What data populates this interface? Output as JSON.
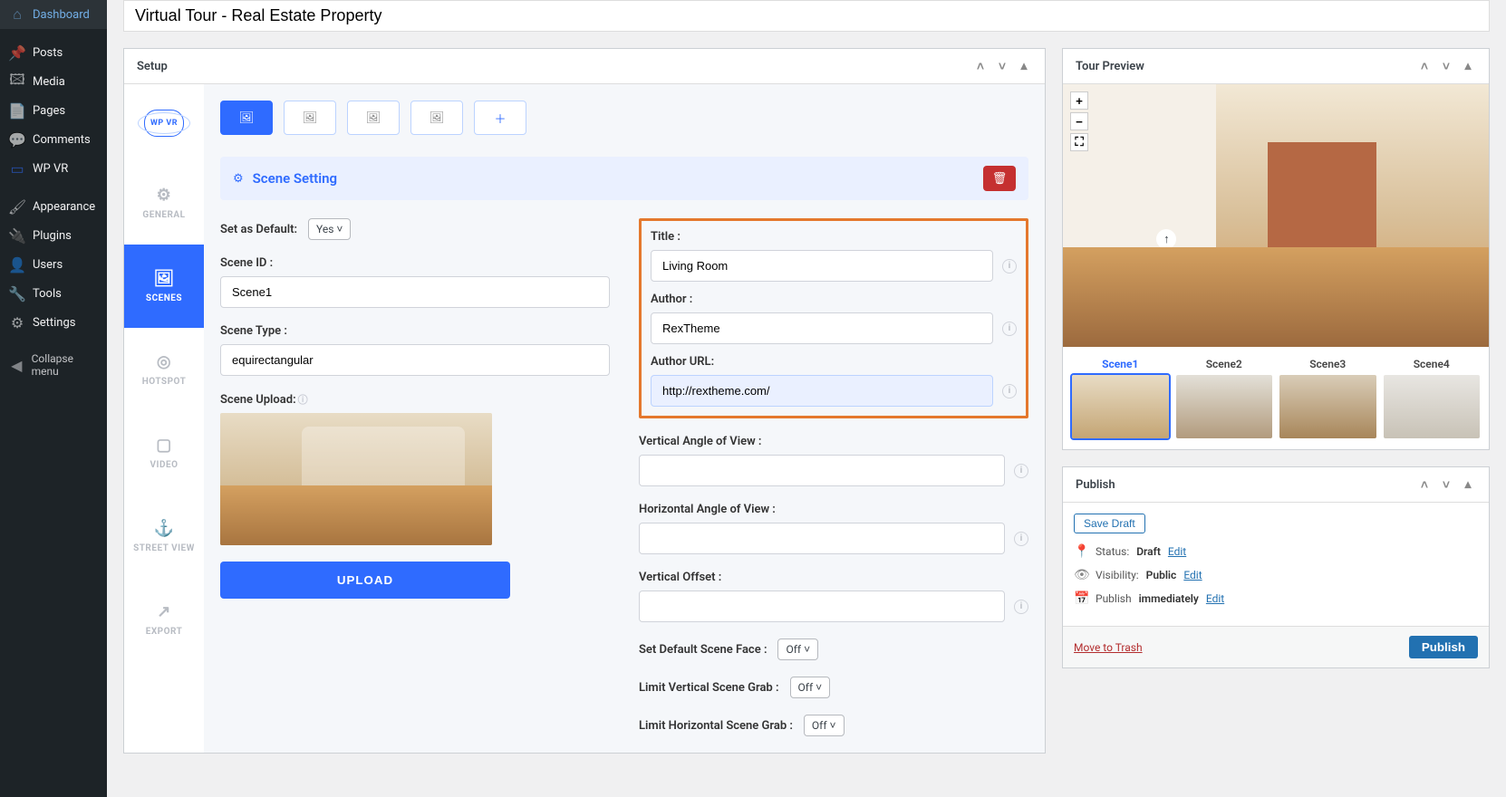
{
  "page_title": "Virtual Tour - Real Estate Property",
  "admin_menu": [
    {
      "label": "Dashboard",
      "icon": "⌂"
    },
    {
      "label": "Posts",
      "icon": "📌"
    },
    {
      "label": "Media",
      "icon": "🖼"
    },
    {
      "label": "Pages",
      "icon": "📄"
    },
    {
      "label": "Comments",
      "icon": "💬"
    },
    {
      "label": "WP VR",
      "icon": "▭"
    },
    {
      "label": "Appearance",
      "icon": "🖌"
    },
    {
      "label": "Plugins",
      "icon": "🔌"
    },
    {
      "label": "Users",
      "icon": "👤"
    },
    {
      "label": "Tools",
      "icon": "🔧"
    },
    {
      "label": "Settings",
      "icon": "⚙"
    }
  ],
  "collapse_menu_label": "Collapse menu",
  "setup": {
    "title": "Setup",
    "logo": "WP VR",
    "tabs": [
      {
        "label": "GENERAL",
        "icon": "⚙"
      },
      {
        "label": "SCENES",
        "icon": "🖼"
      },
      {
        "label": "HOTSPOT",
        "icon": "◎"
      },
      {
        "label": "VIDEO",
        "icon": "▢"
      },
      {
        "label": "STREET VIEW",
        "icon": "⚓"
      },
      {
        "label": "EXPORT",
        "icon": "↗"
      }
    ],
    "scene_toolbar_count": 4,
    "scene_heading": "Scene Setting",
    "form": {
      "set_default_label": "Set as Default:",
      "set_default_value": "Yes",
      "scene_id_label": "Scene ID :",
      "scene_id_value": "Scene1",
      "scene_type_label": "Scene Type :",
      "scene_type_value": "equirectangular",
      "scene_upload_label": "Scene Upload:",
      "upload_btn": "UPLOAD",
      "title_label": "Title :",
      "title_value": "Living Room",
      "author_label": "Author :",
      "author_value": "RexTheme",
      "author_url_label": "Author URL:",
      "author_url_value": "http://rextheme.com/",
      "vaov_label": "Vertical Angle of View :",
      "haov_label": "Horizontal Angle of View :",
      "voffset_label": "Vertical Offset :",
      "default_scene_face_label": "Set Default Scene Face :",
      "default_scene_face_value": "Off",
      "limit_vertical_label": "Limit Vertical Scene Grab :",
      "limit_vertical_value": "Off",
      "limit_horizontal_label": "Limit Horizontal Scene Grab :",
      "limit_horizontal_value": "Off"
    }
  },
  "tour_preview": {
    "title": "Tour Preview",
    "scenes": [
      "Scene1",
      "Scene2",
      "Scene3",
      "Scene4"
    ]
  },
  "publish": {
    "title": "Publish",
    "save_draft": "Save Draft",
    "status_label": "Status:",
    "status_value": "Draft",
    "visibility_label": "Visibility:",
    "visibility_value": "Public",
    "publish_label": "Publish",
    "publish_value": "immediately",
    "edit": "Edit",
    "move_trash": "Move to Trash",
    "publish_btn": "Publish"
  }
}
